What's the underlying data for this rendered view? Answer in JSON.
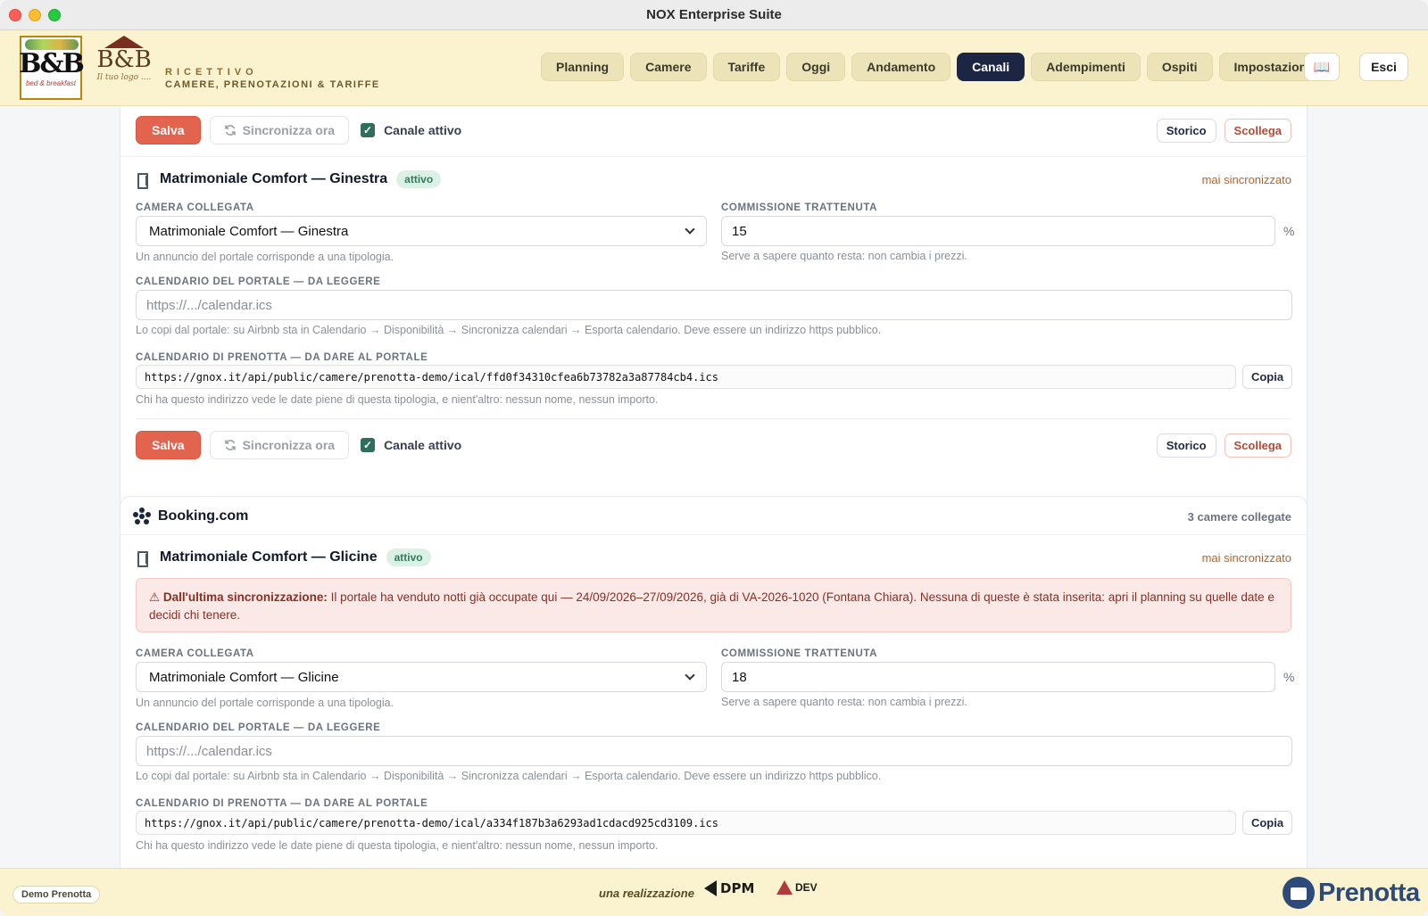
{
  "window": {
    "title": "NOX Enterprise Suite"
  },
  "header": {
    "logo1": {
      "mark": "B&B",
      "sub": "bed & breakfast"
    },
    "logo2": {
      "mark": "B&B",
      "sub": "Il tuo logo ...."
    },
    "brand_line1": "RICETTIVO",
    "brand_line2": "CAMERE, PRENOTAZIONI & TARIFFE",
    "nav": [
      {
        "label": "Planning",
        "active": false
      },
      {
        "label": "Camere",
        "active": false
      },
      {
        "label": "Tariffe",
        "active": false
      },
      {
        "label": "Oggi",
        "active": false
      },
      {
        "label": "Andamento",
        "active": false
      },
      {
        "label": "Canali",
        "active": true
      },
      {
        "label": "Adempimenti",
        "active": false
      },
      {
        "label": "Ospiti",
        "active": false
      },
      {
        "label": "Impostazioni",
        "active": false
      }
    ],
    "book_icon": "📖",
    "logout_label": "Esci"
  },
  "actions": {
    "save_label": "Salva",
    "sync_label": "Sincronizza ora",
    "active_label": "Canale attivo",
    "history_label": "Storico",
    "unlink_label": "Scollega",
    "copy_label": "Copia"
  },
  "labels": {
    "linked_room": "CAMERA COLLEGATA",
    "linked_room_hint": "Un annuncio del portale corrisponde a una tipologia.",
    "commission": "COMMISSIONE TRATTENUTA",
    "commission_hint": "Serve a sapere quanto resta: non cambia i prezzi.",
    "percent": "%",
    "portal_calendar": "CALENDARIO DEL PORTALE — DA LEGGERE",
    "portal_calendar_placeholder": "https://.../calendar.ics",
    "portal_calendar_hint": "Lo copi dal portale: su Airbnb sta in Calendario → Disponibilità → Sincronizza calendari → Esporta calendario. Deve essere un indirizzo https pubblico.",
    "prenotta_calendar": "CALENDARIO DI PRENOTTA — DA DARE AL PORTALE",
    "prenotta_calendar_hint": "Chi ha questo indirizzo vede le date piene di questa tipologia, e nient'altro: nessun nome, nessun importo."
  },
  "channel1": {
    "room": {
      "title": "Matrimoniale Comfort — Ginestra",
      "status": "attivo",
      "sync_state": "mai sincronizzato",
      "linked_room": "Matrimoniale Comfort — Ginestra",
      "commission": "15",
      "ical_url": "https://gnox.it/api/public/camere/prenotta-demo/ical/ffd0f34310cfea6b73782a3a87784cb4.ics"
    }
  },
  "channel2": {
    "name": "Booking.com",
    "meta": "3 camere collegate",
    "room": {
      "title": "Matrimoniale Comfort — Glicine",
      "status": "attivo",
      "sync_state": "mai sincronizzato",
      "alert_icon": "⚠",
      "alert_title": "Dall'ultima sincronizzazione:",
      "alert_text": "Il portale ha venduto notti già occupate qui — 24/09/2026–27/09/2026, già di VA-2026-1020 (Fontana Chiara). Nessuna di queste è stata inserita: apri il planning su quelle date e decidi chi tenere.",
      "linked_room": "Matrimoniale Comfort — Glicine",
      "commission": "18",
      "ical_url": "https://gnox.it/api/public/camere/prenotta-demo/ical/a334f187b3a6293ad1cdacd925cd3109.ics"
    }
  },
  "footer": {
    "demo_label": "Demo Prenotta",
    "credit": "una realizzazione",
    "dpm": "DPM",
    "dev": "DEV",
    "brand": "Prenotta"
  },
  "colors": {
    "header_bg": "#fbf3cf",
    "nav_active": "#1c2541",
    "save_button": "#e2644f",
    "badge_active": "#dcf1e6",
    "alert_bg": "#fbe9e7"
  }
}
